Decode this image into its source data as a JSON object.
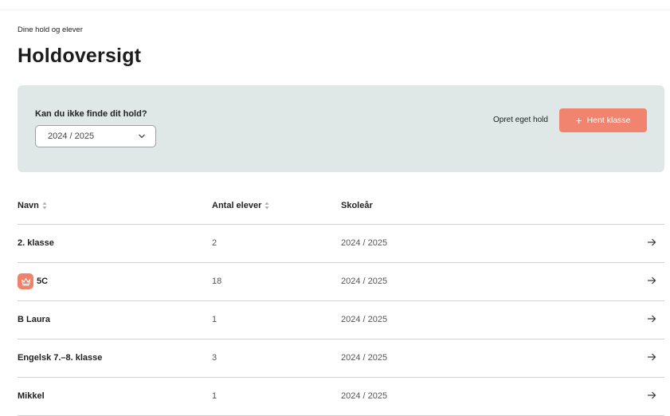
{
  "header": {
    "breadcrumb": "Dine hold og elever",
    "title": "Holdoversigt"
  },
  "panel": {
    "question": "Kan du ikke finde dit hold?",
    "school_year_select": {
      "value": "2024 / 2025"
    },
    "create_link": "Opret eget hold",
    "fetch_button": {
      "icon": "plus-icon",
      "label": "Hent klasse"
    }
  },
  "colors": {
    "accent": "#f0846f",
    "panel_bg": "#dfe7e7"
  },
  "table": {
    "columns": [
      {
        "label": "Navn",
        "sortable": true
      },
      {
        "label": "Antal elever",
        "sortable": true
      },
      {
        "label": "Skoleår",
        "sortable": false
      }
    ],
    "rows": [
      {
        "name": "2. klasse",
        "count": "2",
        "year": "2024 / 2025",
        "badge": false
      },
      {
        "name": "5C",
        "count": "18",
        "year": "2024 / 2025",
        "badge": true,
        "badge_icon": "crown-icon"
      },
      {
        "name": "B Laura",
        "count": "1",
        "year": "2024 / 2025",
        "badge": false
      },
      {
        "name": "Engelsk 7.–8. klasse",
        "count": "3",
        "year": "2024 / 2025",
        "badge": false
      },
      {
        "name": "Mikkel",
        "count": "1",
        "year": "2024 / 2025",
        "badge": false
      }
    ]
  }
}
